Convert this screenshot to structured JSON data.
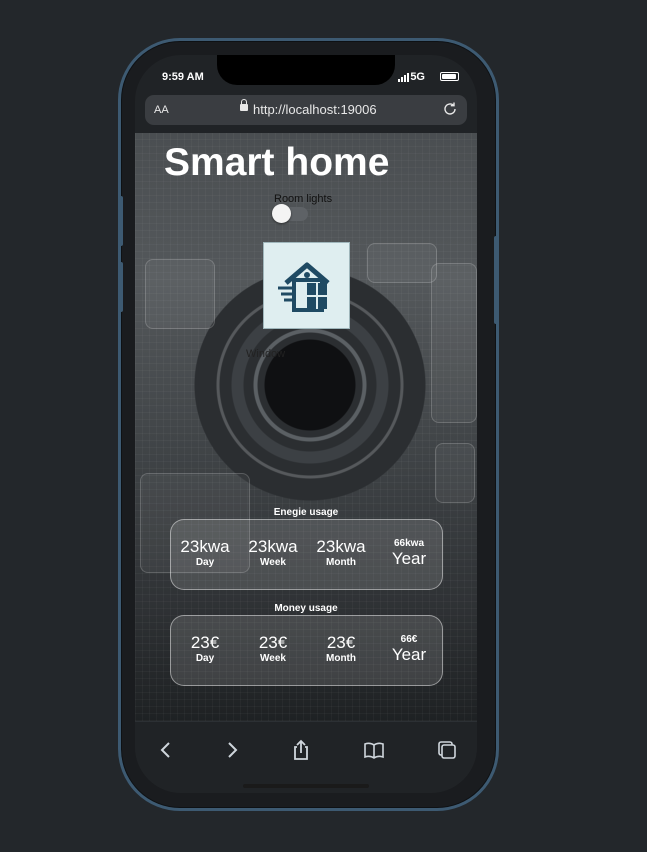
{
  "status_bar": {
    "time": "9:59 AM",
    "network": "5G"
  },
  "browser": {
    "text_size_label": "AA",
    "url": "http://localhost:19006"
  },
  "page": {
    "title": "Smart home",
    "room_lights_label": "Room lights",
    "room_lights_on": false,
    "window_label": "Window",
    "energy": {
      "heading": "Enegie usage",
      "day": {
        "value": "23kwa",
        "period": "Day"
      },
      "week": {
        "value": "23kwa",
        "period": "Week"
      },
      "month": {
        "value": "23kwa",
        "period": "Month"
      },
      "year": {
        "value": "66kwa",
        "period": "Year"
      }
    },
    "money": {
      "heading": "Money usage",
      "day": {
        "value": "23€",
        "period": "Day"
      },
      "week": {
        "value": "23€",
        "period": "Week"
      },
      "month": {
        "value": "23€",
        "period": "Month"
      },
      "year": {
        "value": "66€",
        "period": "Year"
      }
    }
  },
  "colors": {
    "frame": "#3d5a72",
    "background": "#23272b",
    "logo_bg": "#dfeef0",
    "logo_fg": "#1f4a63"
  },
  "icons": [
    "back-icon",
    "forward-icon",
    "share-icon",
    "bookmarks-icon",
    "tabs-icon",
    "reload-icon",
    "lock-icon",
    "smart-home-logo-icon"
  ]
}
